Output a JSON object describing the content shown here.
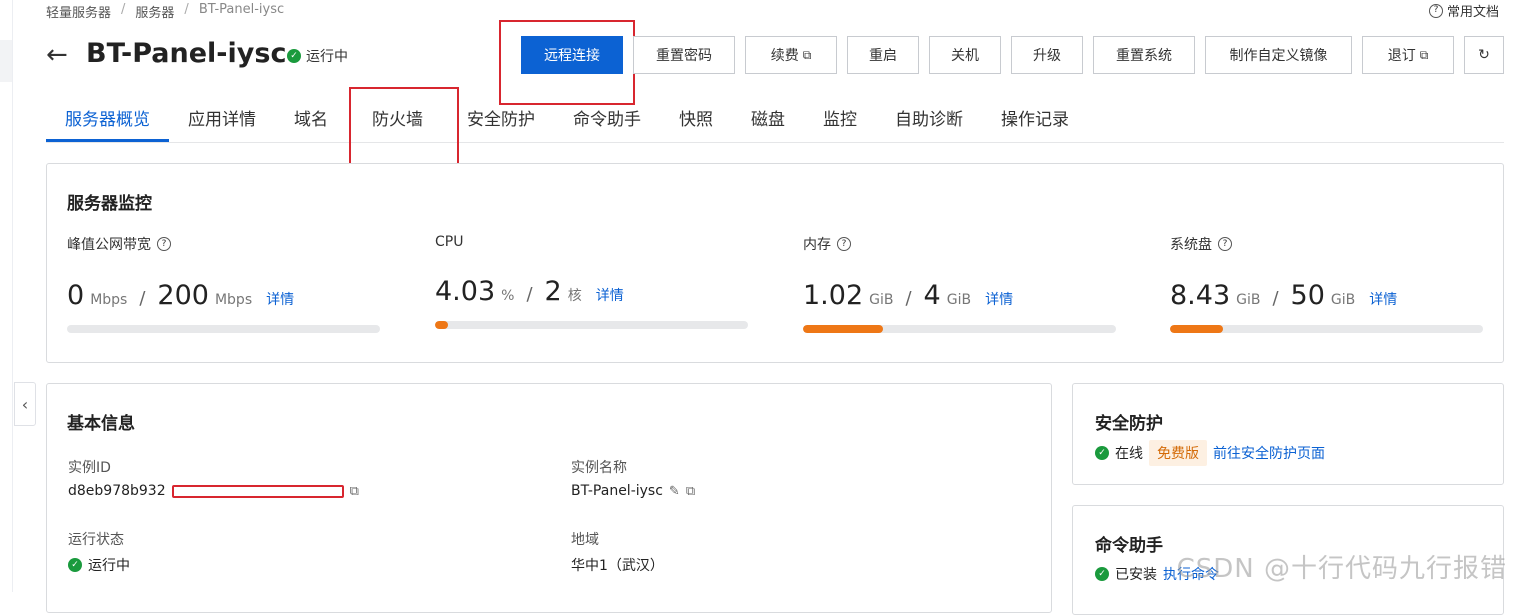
{
  "breadcrumb": [
    "轻量服务器",
    "服务器",
    "BT-Panel-iysc"
  ],
  "help_docs": "常用文档",
  "title": "BT-Panel-iysc",
  "status": "运行中",
  "toolbar": {
    "remote_connect": "远程连接",
    "reset_password": "重置密码",
    "renew": "续费",
    "restart": "重启",
    "shutdown": "关机",
    "upgrade": "升级",
    "reset_system": "重置系统",
    "make_image": "制作自定义镜像",
    "refund": "退订"
  },
  "tabs": [
    "服务器概览",
    "应用详情",
    "域名",
    "防火墙",
    "安全防护",
    "命令助手",
    "快照",
    "磁盘",
    "监控",
    "自助诊断",
    "操作记录"
  ],
  "active_tab": "服务器概览",
  "monitor": {
    "title": "服务器监控",
    "detail_link": "详情",
    "metrics": [
      {
        "label": "峰值公网带宽",
        "used": "0",
        "used_unit": "Mbps",
        "total": "200",
        "total_unit": "Mbps",
        "fraction": 0.0
      },
      {
        "label": "CPU",
        "used": "4.03",
        "used_unit": "%",
        "total": "2",
        "total_unit": "核",
        "fraction": 0.0403
      },
      {
        "label": "内存",
        "used": "1.02",
        "used_unit": "GiB",
        "total": "4",
        "total_unit": "GiB",
        "fraction": 0.255
      },
      {
        "label": "系统盘",
        "used": "8.43",
        "used_unit": "GiB",
        "total": "50",
        "total_unit": "GiB",
        "fraction": 0.1686
      }
    ]
  },
  "basic_info": {
    "title": "基本信息",
    "instance_id_label": "实例ID",
    "instance_id": "d8eb978b932",
    "instance_name_label": "实例名称",
    "instance_name": "BT-Panel-iysc",
    "run_state_label": "运行状态",
    "run_state": "运行中",
    "region_label": "地域",
    "region": "华中1（武汉）"
  },
  "security": {
    "title": "安全防护",
    "state": "在线",
    "tag": "免费版",
    "link": "前往安全防护页面"
  },
  "command_helper": {
    "title": "命令助手",
    "state": "已安装",
    "link": "执行命令"
  },
  "watermark": "CSDN @十行代码九行报错",
  "colors": {
    "primary": "#0c62d3",
    "success": "#1a9a3d",
    "progress": "#ee7716",
    "annotation": "#d8262f"
  }
}
